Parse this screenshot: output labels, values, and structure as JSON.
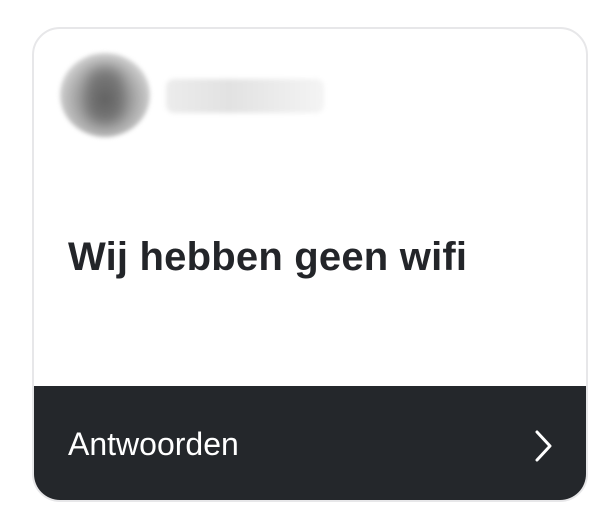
{
  "card": {
    "message": "Wij hebben geen wifi",
    "reply_label": "Antwoorden",
    "chevron_icon": "chevron-right-icon",
    "sender_blurred": true
  },
  "colors": {
    "reply_bar_bg": "#24272b",
    "reply_text": "#ffffff",
    "message_text": "#232529",
    "card_border": "#e7e7e9"
  }
}
